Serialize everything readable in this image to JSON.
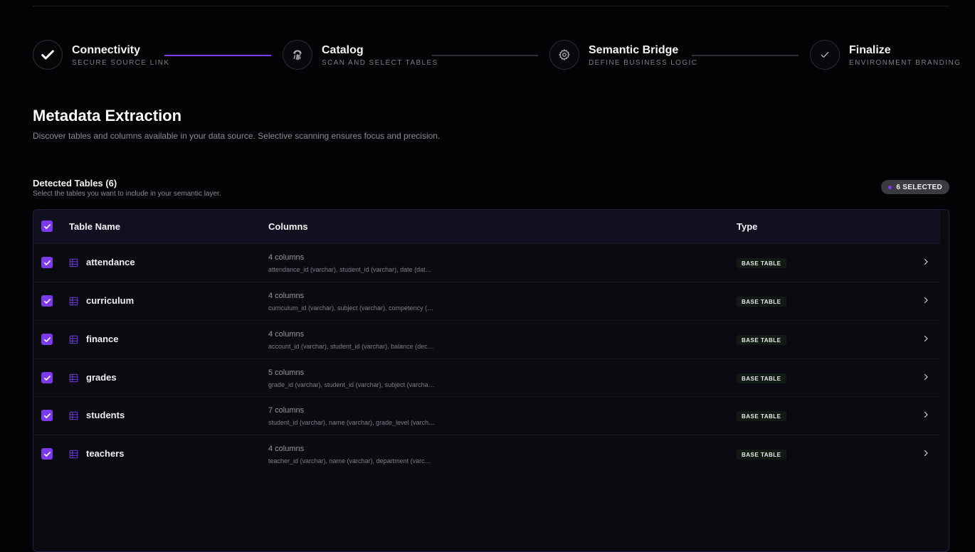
{
  "stepper": {
    "steps": [
      {
        "title": "Connectivity",
        "subtitle": "SECURE SOURCE LINK",
        "state": "done",
        "icon": "check-icon"
      },
      {
        "title": "Catalog",
        "subtitle": "SCAN AND SELECT TABLES",
        "state": "active",
        "icon": "fingerprint-icon"
      },
      {
        "title": "Semantic Bridge",
        "subtitle": "DEFINE BUSINESS LOGIC",
        "state": "pending",
        "icon": "gear-icon"
      },
      {
        "title": "Finalize",
        "subtitle": "ENVIRONMENT BRANDING",
        "state": "pending",
        "icon": "check-icon"
      }
    ]
  },
  "page": {
    "title": "Metadata Extraction",
    "description": "Discover tables and columns available in your data source. Selective scanning ensures focus and precision."
  },
  "section": {
    "title": "Detected Tables (6)",
    "subtitle": "Select the tables you want to include in your semantic layer.",
    "badge": "6 SELECTED"
  },
  "table": {
    "headers": {
      "name": "Table Name",
      "columns": "Columns",
      "type": "Type"
    },
    "rows": [
      {
        "name": "attendance",
        "count": "4 columns",
        "cols": "attendance_id (varchar), student_id (varchar), date (dat…",
        "type": "BASE TABLE",
        "checked": true
      },
      {
        "name": "curriculum",
        "count": "4 columns",
        "cols": "curriculum_id (varchar), subject (varchar), competency (…",
        "type": "BASE TABLE",
        "checked": true
      },
      {
        "name": "finance",
        "count": "4 columns",
        "cols": "account_id (varchar), student_id (varchar), balance (dec…",
        "type": "BASE TABLE",
        "checked": true
      },
      {
        "name": "grades",
        "count": "5 columns",
        "cols": "grade_id (varchar), student_id (varchar), subject (varcha…",
        "type": "BASE TABLE",
        "checked": true
      },
      {
        "name": "students",
        "count": "7 columns",
        "cols": "student_id (varchar), name (varchar), grade_level (varch…",
        "type": "BASE TABLE",
        "checked": true
      },
      {
        "name": "teachers",
        "count": "4 columns",
        "cols": "teacher_id (varchar), name (varchar), department (varc…",
        "type": "BASE TABLE",
        "checked": true
      }
    ]
  },
  "colors": {
    "accent": "#7c3aed",
    "background": "#030305"
  }
}
